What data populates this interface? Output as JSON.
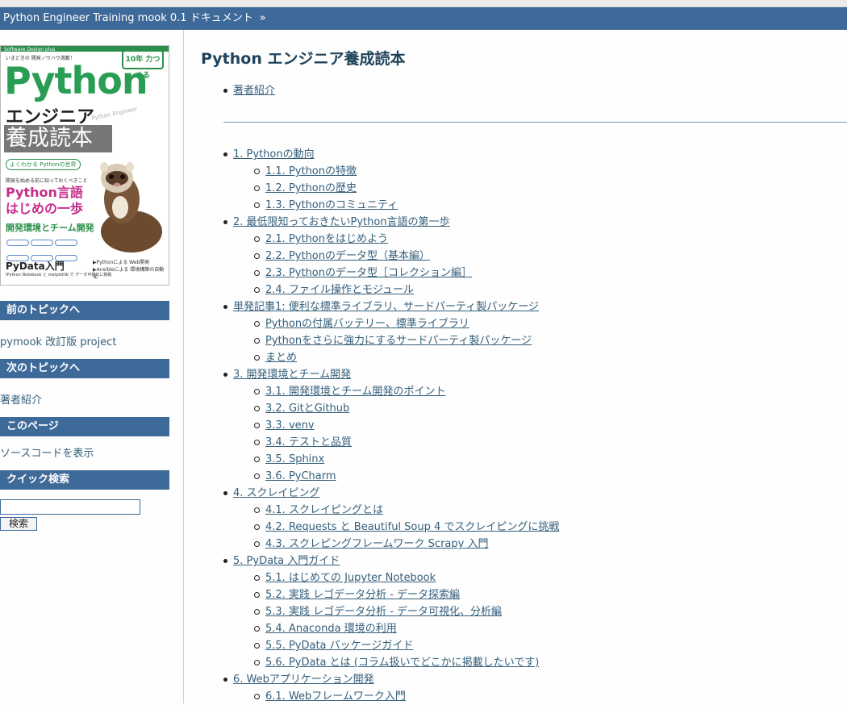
{
  "relbar": {
    "title": "Python Engineer Training mook 0.1 ドキュメント",
    "sep": "»"
  },
  "cover": {
    "brand": "Software Design plus",
    "top_line": "いまどきの 開発ノウハウ満載！",
    "badge": "10年 力つくる",
    "python": "Python",
    "engineer": "エンジニア",
    "subtitle_en": "Python Engineer",
    "yosei": "養成読本",
    "world": "よくわかる Pythonの世界",
    "small": "開発を始める前に知っておくべきこと",
    "pink1": "Python言語",
    "pink2": "はじめの一歩",
    "dev": "開発環境とチーム開発",
    "pydata": "PyData入門",
    "ipy": "IPython Notebook と matplotlib で データ可視化に挑戦",
    "web1": "▶Pythonによる Web開発",
    "web2": "▶Ansibleによる 環境構築の自動化"
  },
  "sidebar": {
    "prev_heading": "前のトピックへ",
    "prev_link": "pymook 改訂版 project",
    "next_heading": "次のトピックへ",
    "next_link": "著者紹介",
    "this_heading": "このページ",
    "source_link": "ソースコードを表示",
    "search_heading": "クイック検索",
    "search_button": "検索"
  },
  "main": {
    "title": "Python エンジニア養成読本",
    "intro_link": "著者紹介",
    "toc": [
      {
        "level": 1,
        "text": "1. Pythonの動向"
      },
      {
        "level": 2,
        "text": "1.1. Pythonの特徴"
      },
      {
        "level": 2,
        "text": "1.2. Pythonの歴史"
      },
      {
        "level": 2,
        "text": "1.3. Pythonのコミュニティ"
      },
      {
        "level": 1,
        "text": "2. 最低限知っておきたいPython言語の第一歩"
      },
      {
        "level": 2,
        "text": "2.1. Pythonをはじめよう"
      },
      {
        "level": 2,
        "text": "2.2. Pythonのデータ型（基本編）"
      },
      {
        "level": 2,
        "text": "2.3. Pythonのデータ型［コレクション編］"
      },
      {
        "level": 2,
        "text": "2.4. ファイル操作とモジュール"
      },
      {
        "level": 1,
        "text": "単発記事1: 便利な標準ライブラリ、サードパーティ製パッケージ"
      },
      {
        "level": 2,
        "text": "Pythonの付属バッテリー、標準ライブラリ"
      },
      {
        "level": 2,
        "text": "Pythonをさらに強力にするサードパーティ製パッケージ"
      },
      {
        "level": 2,
        "text": "まとめ"
      },
      {
        "level": 1,
        "text": "3. 開発環境とチーム開発"
      },
      {
        "level": 2,
        "text": "3.1. 開発環境とチーム開発のポイント"
      },
      {
        "level": 2,
        "text": "3.2. GitとGithub"
      },
      {
        "level": 2,
        "text": "3.3. venv"
      },
      {
        "level": 2,
        "text": "3.4. テストと品質"
      },
      {
        "level": 2,
        "text": "3.5. Sphinx"
      },
      {
        "level": 2,
        "text": "3.6. PyCharm"
      },
      {
        "level": 1,
        "text": "4. スクレイピング"
      },
      {
        "level": 2,
        "text": "4.1. スクレイピングとは"
      },
      {
        "level": 2,
        "text": "4.2. Requests と Beautiful Soup 4 でスクレイピングに挑戦"
      },
      {
        "level": 2,
        "text": "4.3. スクレピングフレームワーク Scrapy 入門"
      },
      {
        "level": 1,
        "text": "5. PyData 入門ガイド"
      },
      {
        "level": 2,
        "text": "5.1. はじめての Jupyter Notebook"
      },
      {
        "level": 2,
        "text": "5.2. 実践 レゴデータ分析 - データ探索編"
      },
      {
        "level": 2,
        "text": "5.3. 実践 レゴデータ分析 - データ可視化、分析編"
      },
      {
        "level": 2,
        "text": "5.4. Anaconda 環境の利用"
      },
      {
        "level": 2,
        "text": "5.5. PyData パッケージガイド"
      },
      {
        "level": 2,
        "text": "5.6. PyData とは (コラム扱いでどこかに掲載したいです)"
      },
      {
        "level": 1,
        "text": "6. Webアプリケーション開発"
      },
      {
        "level": 2,
        "text": "6.1. Webフレームワーク入門"
      }
    ]
  }
}
